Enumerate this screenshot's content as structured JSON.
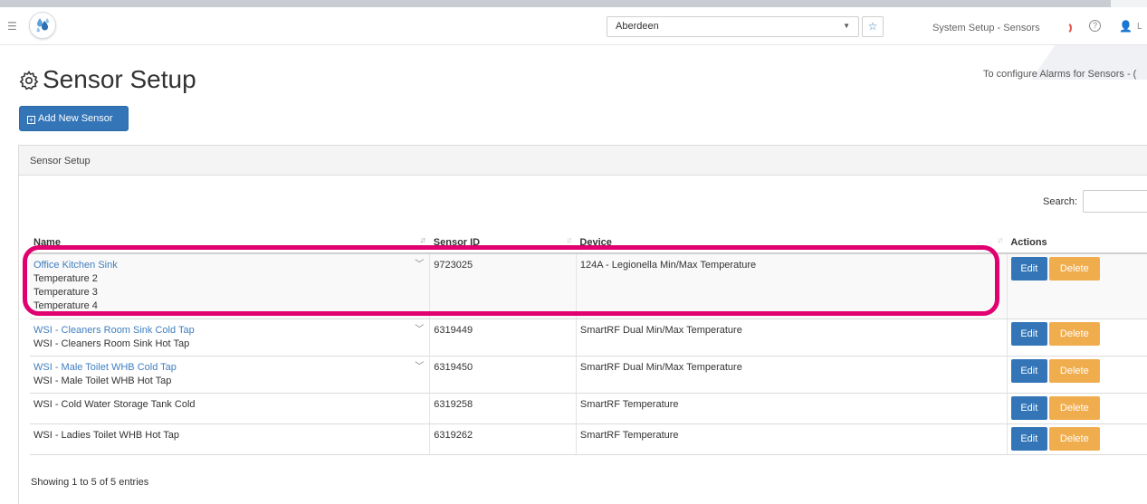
{
  "header": {
    "location": "Aberdeen",
    "page_crumb": "System Setup - Sensors",
    "user_initial": "L"
  },
  "page": {
    "title": "Sensor Setup",
    "alarm_note": "To configure Alarms for Sensors - (",
    "add_button": "Add New Sensor"
  },
  "panel": {
    "heading": "Sensor Setup",
    "search_label": "Search:",
    "search_value": ""
  },
  "table": {
    "columns": [
      "Name",
      "Sensor ID",
      "Device",
      "Actions"
    ],
    "rows": [
      {
        "name": "Office Kitchen Sink",
        "sub_names": [
          "Temperature 2",
          "Temperature 3",
          "Temperature 4"
        ],
        "sensor_id": "9723025",
        "device": "124A - Legionella Min/Max Temperature"
      },
      {
        "name": "WSI - Cleaners Room Sink Cold Tap",
        "sub_names": [
          "WSI - Cleaners Room Sink Hot Tap"
        ],
        "sensor_id": "6319449",
        "device": "SmartRF Dual Min/Max Temperature"
      },
      {
        "name": "WSI - Male Toilet WHB Cold Tap",
        "sub_names": [
          "WSI - Male Toilet WHB Hot Tap"
        ],
        "sensor_id": "6319450",
        "device": "SmartRF Dual Min/Max Temperature"
      },
      {
        "name": "WSI - Cold Water Storage Tank Cold",
        "sub_names": [],
        "sensor_id": "6319258",
        "device": "SmartRF Temperature"
      },
      {
        "name": "WSI - Ladies Toilet WHB Hot Tap",
        "sub_names": [],
        "sensor_id": "6319262",
        "device": "SmartRF Temperature"
      }
    ],
    "edit_label": "Edit",
    "delete_label": "Delete",
    "info": "Showing 1 to 5 of 5 entries"
  },
  "colors": {
    "primary": "#3375b7",
    "warning": "#f0ad4e",
    "link": "#3f7ec0",
    "highlight": "#e0006f"
  }
}
